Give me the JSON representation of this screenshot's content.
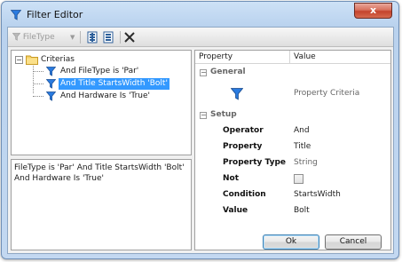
{
  "window": {
    "title": "Filter Editor",
    "close_glyph": "x"
  },
  "toolbar": {
    "filetype_label": "FileType",
    "dropdown_arrow": "▼",
    "delete_glyph": "✕"
  },
  "tree": {
    "expander": "−",
    "root_label": "Criterias",
    "items": [
      {
        "label": "And FileType is 'Par'",
        "selected": false
      },
      {
        "label": "And Title StartsWidth 'Bolt'",
        "selected": true
      },
      {
        "label": "And Hardware Is 'True'",
        "selected": false
      }
    ]
  },
  "expression": {
    "text": "FileType is 'Par' And Title StartsWidth 'Bolt' And Hardware Is 'True'"
  },
  "grid": {
    "header_property": "Property",
    "header_value": "Value",
    "general": {
      "expander": "−",
      "label": "General",
      "criteria_value": "Property Criteria"
    },
    "setup": {
      "expander": "−",
      "label": "Setup",
      "rows": {
        "operator": {
          "name": "Operator",
          "value": "And"
        },
        "property": {
          "name": "Property",
          "value": "Title"
        },
        "property_type": {
          "name": "Property Type",
          "value": "String"
        },
        "not": {
          "name": "Not",
          "checked": false
        },
        "condition": {
          "name": "Condition",
          "value": "StartsWidth"
        },
        "value": {
          "name": "Value",
          "value": "Bolt"
        }
      }
    }
  },
  "buttons": {
    "ok": "Ok",
    "cancel": "Cancel"
  },
  "colors": {
    "accent_selection": "#3399ff",
    "filter_icon": "#1e6fd0"
  }
}
